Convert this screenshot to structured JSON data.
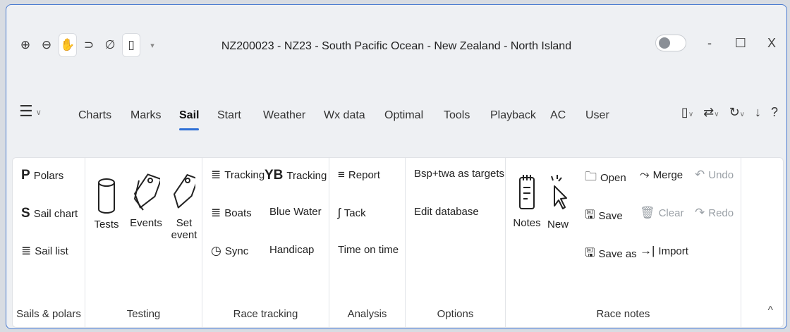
{
  "window": {
    "title": "NZ200023 - NZ23 - South Pacific Ocean - New Zealand - North Island"
  },
  "quick_access": [
    {
      "icon": "zoom-in-icon",
      "glyph": "⊕"
    },
    {
      "icon": "zoom-out-icon",
      "glyph": "⊖"
    },
    {
      "icon": "pan-hand-icon",
      "glyph": "✋"
    },
    {
      "icon": "lasso-icon",
      "glyph": "⊃"
    },
    {
      "icon": "measure-icon",
      "glyph": "∅"
    },
    {
      "icon": "device-icon",
      "glyph": "▯"
    },
    {
      "icon": "customize-icon",
      "glyph": "▾"
    }
  ],
  "window_controls": {
    "minimize": "-",
    "maximize": "☐",
    "close": "X"
  },
  "menu": {
    "hamburger": "☰",
    "hamburger_caret": "∨",
    "tabs": [
      "Charts",
      "Marks",
      "Sail",
      "Start",
      "Weather",
      "Wx data",
      "Optimal",
      "Tools",
      "Playback",
      "AC",
      "User"
    ],
    "active_tab": "Sail",
    "right_icons": [
      "▯",
      "⇄",
      "↻",
      "↓",
      "?"
    ],
    "caret": "∨"
  },
  "ribbon": {
    "groups": {
      "sails_polars": {
        "label": "Sails & polars",
        "items": [
          {
            "icon": "P",
            "label": "Polars"
          },
          {
            "icon": "S",
            "label": "Sail chart"
          },
          {
            "icon": "≣",
            "label": "Sail list"
          }
        ]
      },
      "testing": {
        "label": "Testing",
        "buttons": [
          "Tests",
          "Events",
          "Set event"
        ],
        "set_event_line1": "Set",
        "set_event_line2": "event"
      },
      "race_tracking": {
        "label": "Race tracking",
        "items": [
          {
            "icon": "≣",
            "label": "Tracking"
          },
          {
            "icon": "YB",
            "label": "Tracking"
          },
          {
            "icon": "≣",
            "label": "Boats"
          },
          {
            "icon": "",
            "label": "Blue Water"
          },
          {
            "icon": "◷",
            "label": "Sync"
          },
          {
            "icon": "",
            "label": "Handicap"
          }
        ]
      },
      "analysis": {
        "label": "Analysis",
        "items": [
          {
            "icon": "≡",
            "label": "Report"
          },
          {
            "icon": "ʃ",
            "label": "Tack"
          },
          {
            "icon": "",
            "label": "Time on time"
          }
        ]
      },
      "options": {
        "label": "Options",
        "items": [
          "Bsp+twa as targets",
          "Edit database"
        ]
      },
      "race_notes": {
        "label": "Race notes",
        "big": [
          "Notes",
          "New"
        ],
        "items": [
          {
            "icon": "🗀",
            "label": "Open",
            "disabled": false
          },
          {
            "icon": "⤳",
            "label": "Merge",
            "disabled": false
          },
          {
            "icon": "↶",
            "label": "Undo",
            "disabled": true
          },
          {
            "icon": "🖫",
            "label": "Save",
            "disabled": false
          },
          {
            "icon": "🗑",
            "label": "Clear",
            "disabled": true
          },
          {
            "icon": "↷",
            "label": "Redo",
            "disabled": true
          },
          {
            "icon": "🖫",
            "label": "Save as",
            "disabled": false
          },
          {
            "icon": "→|",
            "label": "Import",
            "disabled": false
          }
        ]
      }
    },
    "collapse": "^"
  }
}
